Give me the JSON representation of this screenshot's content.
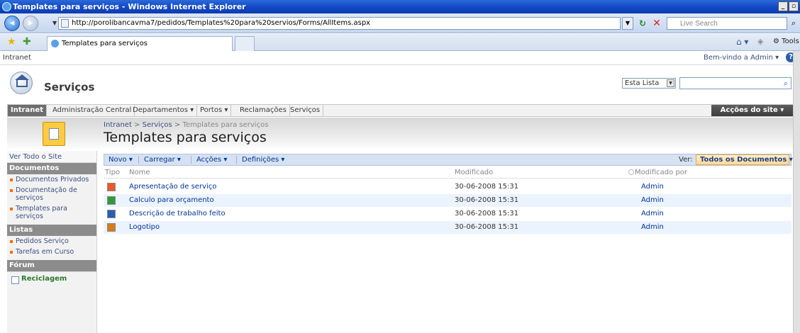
{
  "window": {
    "title": "Templates para serviços - Windows Internet Explorer"
  },
  "browser": {
    "url": "http://porolibancavma7/pedidos/Templates%20para%20servios/Forms/AllItems.aspx",
    "search_placeholder": "Live Search",
    "tab_title": "Templates para serviços",
    "tools_label": "Tools"
  },
  "sp": {
    "top_link": "Intranet",
    "welcome": "Bem-vindo a Admin ▾",
    "site_title": "Serviços",
    "search_scope": "Esta Lista",
    "topnav": [
      "Intranet",
      "Administração Central",
      "Departamentos ▾",
      "Portos ▾",
      "Reclamações",
      "Serviços"
    ],
    "site_actions": "Acções do site ▾",
    "breadcrumb": {
      "root": "Intranet",
      "sep": " > ",
      "site": "Serviços",
      "current": "Templates para serviços"
    },
    "page_title": "Templates para serviços",
    "leftnav": {
      "view_all": "Ver Todo o Site",
      "docs_head": "Documentos",
      "docs": [
        "Documentos Privados",
        "Documentação de serviços",
        "Templates para serviços"
      ],
      "lists_head": "Listas",
      "lists": [
        "Pedidos Serviço",
        "Tarefas em Curso"
      ],
      "forum_head": "Fórum",
      "recycle": "Reciclagem"
    },
    "toolbar": {
      "new": "Novo ▾",
      "upload": "Carregar ▾",
      "actions": "Acções ▾",
      "settings": "Definições ▾",
      "view_label": "Ver:",
      "view_value": "Todos os Documentos ▾"
    },
    "columns": {
      "type": "Tipo",
      "name": "Nome",
      "modified": "Modificado",
      "modified_by": "Modificado por"
    },
    "rows": [
      {
        "icon": "powerpoint-icon",
        "name": "Apresentação de serviço",
        "modified": "30-06-2008 15:31",
        "author": "Admin"
      },
      {
        "icon": "excel-icon",
        "name": "Calculo para orçamento",
        "modified": "30-06-2008 15:31",
        "author": "Admin"
      },
      {
        "icon": "word-icon",
        "name": "Descrição de trabalho feito",
        "modified": "30-06-2008 15:31",
        "author": "Admin"
      },
      {
        "icon": "image-icon",
        "name": "Logotipo",
        "modified": "30-06-2008 15:31",
        "author": "Admin"
      }
    ]
  }
}
